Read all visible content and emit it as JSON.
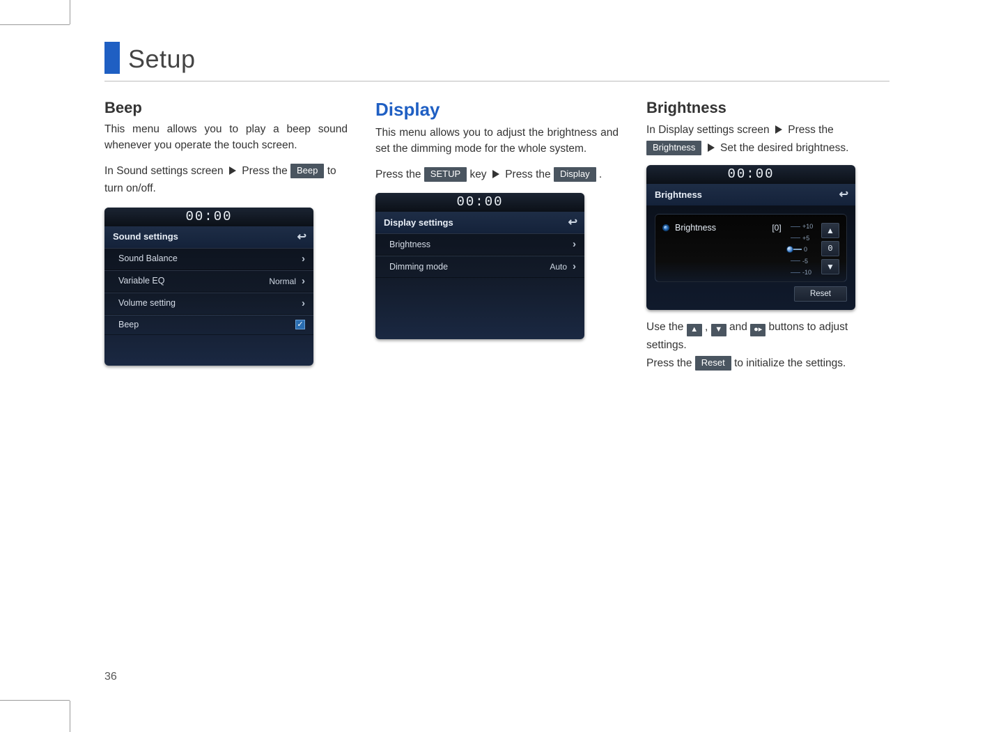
{
  "page": {
    "title": "Setup",
    "number": "36"
  },
  "beep": {
    "heading": "Beep",
    "desc": "This menu allows you to play a beep sound whenever you operate the touch screen.",
    "instr_pre": "In Sound settings screen ",
    "instr_mid": " Press the ",
    "tag": "Beep",
    "instr_post": " to turn on/off."
  },
  "display": {
    "heading": "Display",
    "desc": "This menu allows you to adjust the brightness and set the dimming mode for the whole system.",
    "instr_a": "Press the ",
    "tag_setup": "SETUP",
    "instr_b": " key ",
    "instr_c": " Press the ",
    "tag_display": "Display",
    "instr_d": " ."
  },
  "brightness": {
    "heading": "Brightness",
    "instr_a": "In Display settings screen ",
    "instr_b": " Press the ",
    "tag": "Brightness",
    "instr_c": " Set the desired brightness.",
    "use_a": "Use the ",
    "use_b": " , ",
    "use_c": " and ",
    "use_d": " buttons to adjust settings.",
    "press_a": "Press the ",
    "tag_reset": "Reset",
    "press_b": " to initialize the settings."
  },
  "dev_sound": {
    "clock": "00:00",
    "title": "Sound settings",
    "rows": [
      {
        "label": "Sound Balance",
        "val": ""
      },
      {
        "label": "Variable EQ",
        "val": "Normal"
      },
      {
        "label": "Volume setting",
        "val": ""
      }
    ],
    "beep_label": "Beep"
  },
  "dev_display": {
    "clock": "00:00",
    "title": "Display settings",
    "rows": [
      {
        "label": "Brightness",
        "val": ""
      },
      {
        "label": "Dimming mode",
        "val": "Auto"
      }
    ]
  },
  "dev_bright": {
    "clock": "00:00",
    "title": "Brightness",
    "option": "Brightness",
    "value": "[0]",
    "ticks": [
      "+10",
      "+5",
      "0",
      "-5",
      "-10"
    ],
    "btn_mid": "0",
    "reset": "Reset"
  }
}
